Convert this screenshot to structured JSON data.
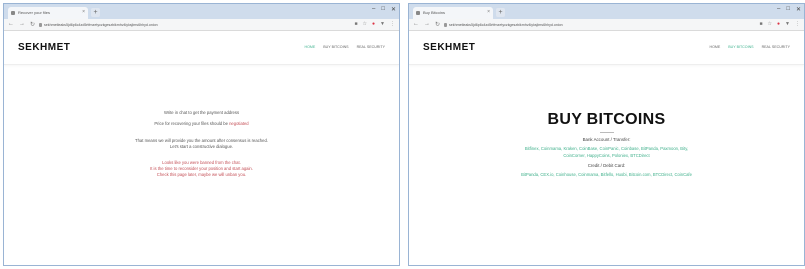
{
  "left": {
    "tab_title": "Recover your files",
    "url": "sekhmetleaks5jd6p6c4zd5rtfmzetyczkgeszbikmhv4iyksjlms6hhyd.onion",
    "logo": "SEKHMET",
    "menu": [
      "HOME",
      "BUY BITCOINS",
      "REAL SECURITY"
    ],
    "message": {
      "line1": "Write in chat to get the payment address",
      "line2_prefix": "Price for recovering your files should be ",
      "line2_link": "negotiated",
      "line3": "That means we will provide you the amount after consensus is reached.",
      "line4": "Let's start a constructive dialogue.",
      "warn1": "Looks like you were banned from the chat.",
      "warn2": "It is the time to reconsider your position and start again.",
      "warn3": "Check this page later, maybe we will unban you."
    }
  },
  "right": {
    "tab_title": "Buy Bitcoins",
    "url": "sekhmetleaks5jd6p6c4zd5rtfmzetyczkgeszbikmhv4iyksjlms6hhyd.onion",
    "logo": "SEKHMET",
    "menu": [
      "HOME",
      "BUY BITCOINS",
      "REAL SECURITY"
    ],
    "title": "BUY BITCOINS",
    "bank_label": "Bank Account / Transfer:",
    "bank_links_1": "Bitfinex, Coinmama, Kraken, CoinBase, CoinPanic, Coinbase, BitPanda, Paxmoon, Bity,",
    "bank_links_2": "CoinCorner, HappyCoins, Poloniex, BTCDirect",
    "card_label": "Credit / Debit Card:",
    "card_links": "BitPanda, CEX.io, Coinhouse, Coinmama, Bitfello, Huobi, Bitcoin.com, BTCDirect, CoinCafe"
  },
  "colors": {
    "accent": "#40b38f",
    "warning": "#c44f56"
  }
}
